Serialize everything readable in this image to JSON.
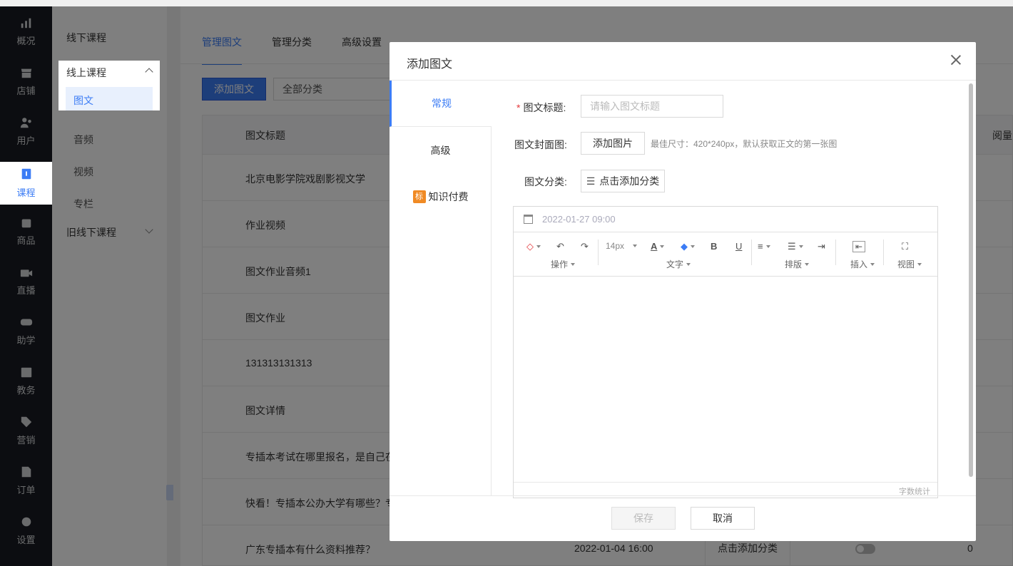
{
  "rail": [
    {
      "label": "概况",
      "icon": "chart-icon"
    },
    {
      "label": "店铺",
      "icon": "store-icon"
    },
    {
      "label": "用户",
      "icon": "users-icon"
    },
    {
      "label": "课程",
      "icon": "book-icon"
    },
    {
      "label": "商品",
      "icon": "bag-icon"
    },
    {
      "label": "直播",
      "icon": "video-camera-icon"
    },
    {
      "label": "助学",
      "icon": "gamepad-icon"
    },
    {
      "label": "教务",
      "icon": "folder-icon"
    },
    {
      "label": "营销",
      "icon": "tag-icon"
    },
    {
      "label": "订单",
      "icon": "document-icon"
    },
    {
      "label": "设置",
      "icon": "gear-icon"
    }
  ],
  "subnav": {
    "offline": "线下课程",
    "online": "线上课程",
    "online_items": [
      "图文",
      "音频",
      "视频",
      "专栏"
    ],
    "old_offline": "旧线下课程"
  },
  "main": {
    "tabs": [
      "管理图文",
      "管理分类",
      "高级设置"
    ],
    "add_button": "添加图文",
    "category_select": "全部分类",
    "columns": {
      "title": "图文标题",
      "read": "阅量"
    },
    "rows": [
      "北京电影学院戏剧影视文学",
      "作业视频",
      "图文作业音频1",
      "图文作业",
      "131313131313",
      "图文详情",
      "专插本考试在哪里报名，是自己在",
      "快看！专插本公办大学有哪些？专",
      "广东专插本有什么资料推荐？"
    ],
    "last_row": {
      "date": "2022-01-04 16:00",
      "category": "点击添加分类",
      "reads": "0"
    }
  },
  "modal": {
    "title": "添加图文",
    "side": [
      "常规",
      "高级",
      "知识付费"
    ],
    "badge": "标",
    "title_label": "图文标题:",
    "title_placeholder": "请输入图文标题",
    "cover_label": "图文封面图:",
    "cover_button": "添加图片",
    "cover_hint": "最佳尺寸：420*240px，默认获取正文的第一张图",
    "category_label": "图文分类:",
    "category_button": "点击添加分类",
    "date": "2022-01-27 09:00",
    "toolbar": {
      "font_size": "14px",
      "groups": [
        "操作",
        "文字",
        "排版",
        "插入",
        "视图"
      ]
    },
    "word_count": "字数统计",
    "save": "保存",
    "cancel": "取消"
  },
  "colors": {
    "accent": "#3b7cf5",
    "rail_bg": "#181b22",
    "badge": "#f08a24"
  }
}
